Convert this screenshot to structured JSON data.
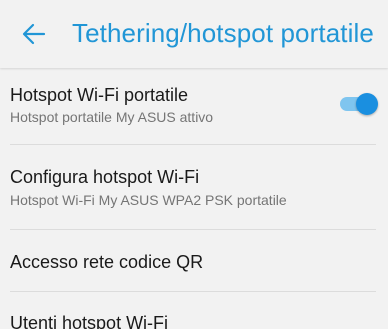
{
  "header": {
    "title": "Tethering/hotspot portatile",
    "back_icon": "arrow-left-icon",
    "accent_color": "#2196d6"
  },
  "settings": [
    {
      "label": "Hotspot Wi-Fi portatile",
      "summary": "Hotspot portatile My ASUS attivo",
      "toggle": true
    },
    {
      "label": "Configura hotspot Wi-Fi",
      "summary": "Hotspot Wi-Fi My ASUS WPA2 PSK portatile"
    },
    {
      "label": "Accesso rete codice QR"
    },
    {
      "label": "Utenti hotspot Wi-Fi"
    }
  ],
  "toggle_state": "on"
}
